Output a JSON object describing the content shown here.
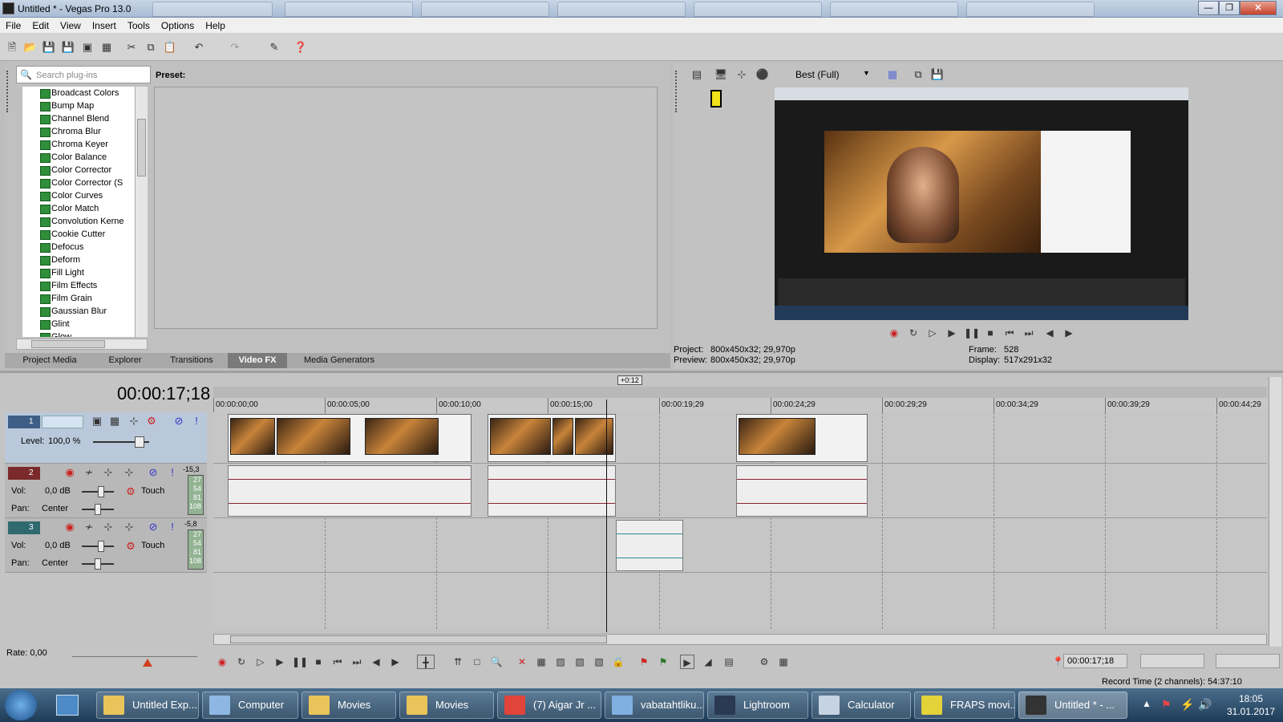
{
  "window": {
    "title": "Untitled * - Vegas Pro 13.0"
  },
  "menu": [
    "File",
    "Edit",
    "View",
    "Insert",
    "Tools",
    "Options",
    "Help"
  ],
  "explorer": {
    "search_placeholder": "Search plug-ins",
    "preset_label": "Preset:",
    "plugins": [
      "Broadcast Colors",
      "Bump Map",
      "Channel Blend",
      "Chroma Blur",
      "Chroma Keyer",
      "Color Balance",
      "Color Corrector",
      "Color Corrector (S",
      "Color Curves",
      "Color Match",
      "Convolution Kerne",
      "Cookie Cutter",
      "Defocus",
      "Deform",
      "Fill Light",
      "Film Effects",
      "Film Grain",
      "Gaussian Blur",
      "Glint",
      "Glow"
    ],
    "tabs": [
      {
        "label": "Project Media",
        "active": false
      },
      {
        "label": "Explorer",
        "active": false
      },
      {
        "label": "Transitions",
        "active": false
      },
      {
        "label": "Video FX",
        "active": true
      },
      {
        "label": "Media Generators",
        "active": false
      }
    ]
  },
  "preview": {
    "quality": "Best (Full)",
    "project_label": "Project:",
    "project_value": "800x450x32; 29,970p",
    "preview_label": "Preview:",
    "preview_value": "800x450x32; 29,970p",
    "frame_label": "Frame:",
    "frame_value": "528",
    "display_label": "Display:",
    "display_value": "517x291x32"
  },
  "timeline": {
    "timecode": "00:00:17;18",
    "loop_marker": "+0:12",
    "ruler": [
      "00:00:00;00",
      "00:00:05;00",
      "00:00:10;00",
      "00:00:15;00",
      "00:00:19;29",
      "00:00:24;29",
      "00:00:29;29",
      "00:00:34;29",
      "00:00:39;29",
      "00:00:44;29"
    ],
    "tracks": [
      {
        "num": "1",
        "type": "video",
        "level_label": "Level:",
        "level_value": "100,0 %"
      },
      {
        "num": "2",
        "type": "audio",
        "vol_label": "Vol:",
        "vol_value": "0,0 dB",
        "pan_label": "Pan:",
        "pan_value": "Center",
        "mode": "Touch",
        "peak": "-15,3",
        "meter": [
          "27",
          "54",
          "81",
          "108"
        ]
      },
      {
        "num": "3",
        "type": "audio",
        "vol_label": "Vol:",
        "vol_value": "0,0 dB",
        "pan_label": "Pan:",
        "pan_value": "Center",
        "mode": "Touch",
        "peak": "-5,8",
        "meter": [
          "27",
          "54",
          "81",
          "108"
        ]
      }
    ],
    "rate_label": "Rate: 0,00",
    "cursor_time": "00:00:17;18",
    "record_time": "Record Time (2 channels): 54:37:10"
  },
  "taskbar": {
    "items": [
      {
        "label": "Untitled Exp...",
        "icon": "folder-icon"
      },
      {
        "label": "Computer",
        "icon": "computer-icon"
      },
      {
        "label": "Movies",
        "icon": "folder-icon"
      },
      {
        "label": "Movies",
        "icon": "folder-icon"
      },
      {
        "label": "(7) Aigar Jr ...",
        "icon": "chrome-icon"
      },
      {
        "label": "vabatahtliku...",
        "icon": "paint-icon"
      },
      {
        "label": "Lightroom",
        "icon": "lightroom-icon"
      },
      {
        "label": "Calculator",
        "icon": "calculator-icon"
      },
      {
        "label": "FRAPS movi...",
        "icon": "fraps-icon"
      },
      {
        "label": "Untitled * - ...",
        "icon": "vegas-icon",
        "active": true
      }
    ],
    "clock_time": "18:05",
    "clock_date": "31.01.2017"
  }
}
